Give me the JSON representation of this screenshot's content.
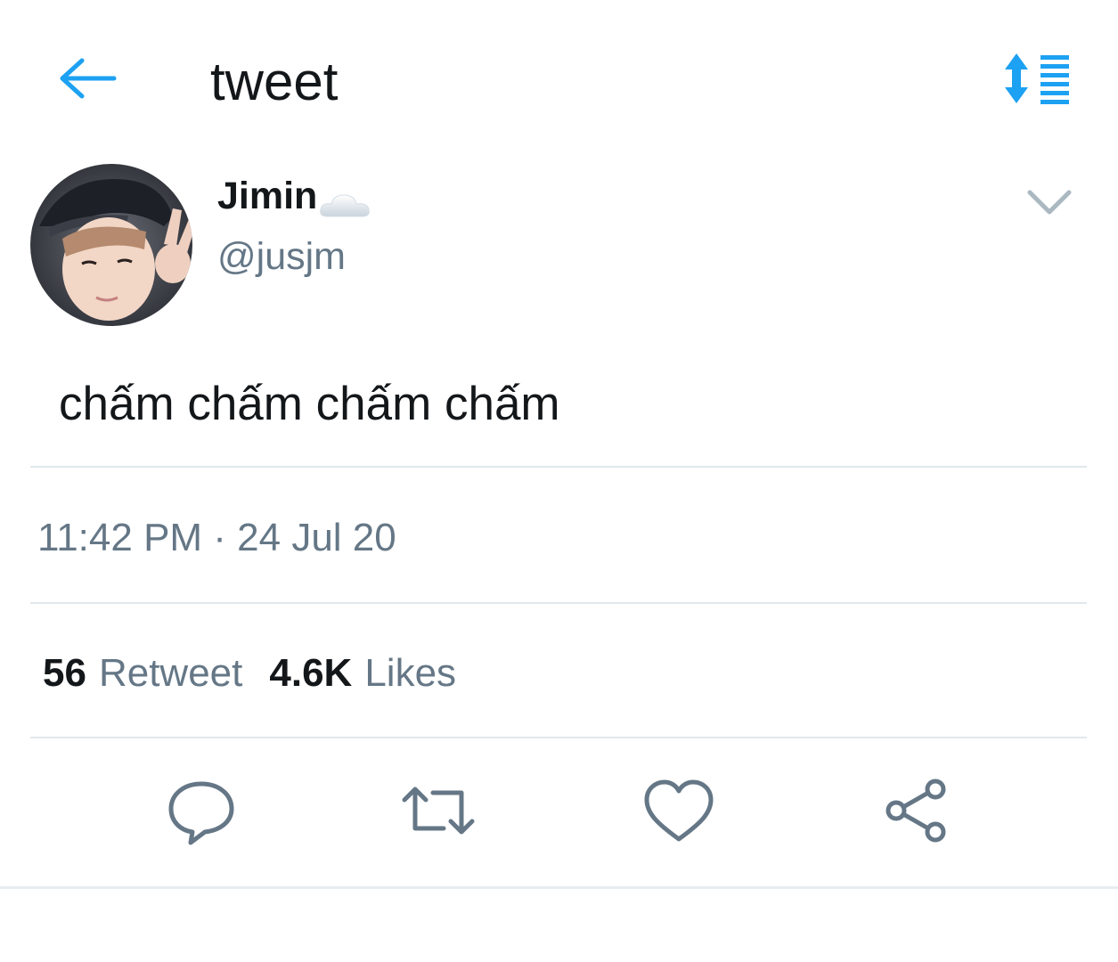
{
  "header": {
    "title": "tweet",
    "back_icon": "arrow-left-icon",
    "sort_icon": "sort-lines-icon",
    "accent_color": "#1da1f2"
  },
  "tweet": {
    "author": {
      "display_name": "Jimin",
      "name_emoji": "cloud-icon",
      "handle": "@jusjm"
    },
    "text": "chấm chấm chấm chấm",
    "timestamp": "11:42 PM · 24 Jul 20",
    "stats": {
      "retweet_count": "56",
      "retweet_label": "Retweet",
      "likes_count": "4.6K",
      "likes_label": "Likes"
    },
    "actions": [
      "reply-icon",
      "retweet-icon",
      "like-icon",
      "share-icon"
    ]
  },
  "colors": {
    "text_primary": "#14171a",
    "text_secondary": "#657786",
    "icon_gray": "#657786",
    "divider": "#e1e8ed"
  }
}
